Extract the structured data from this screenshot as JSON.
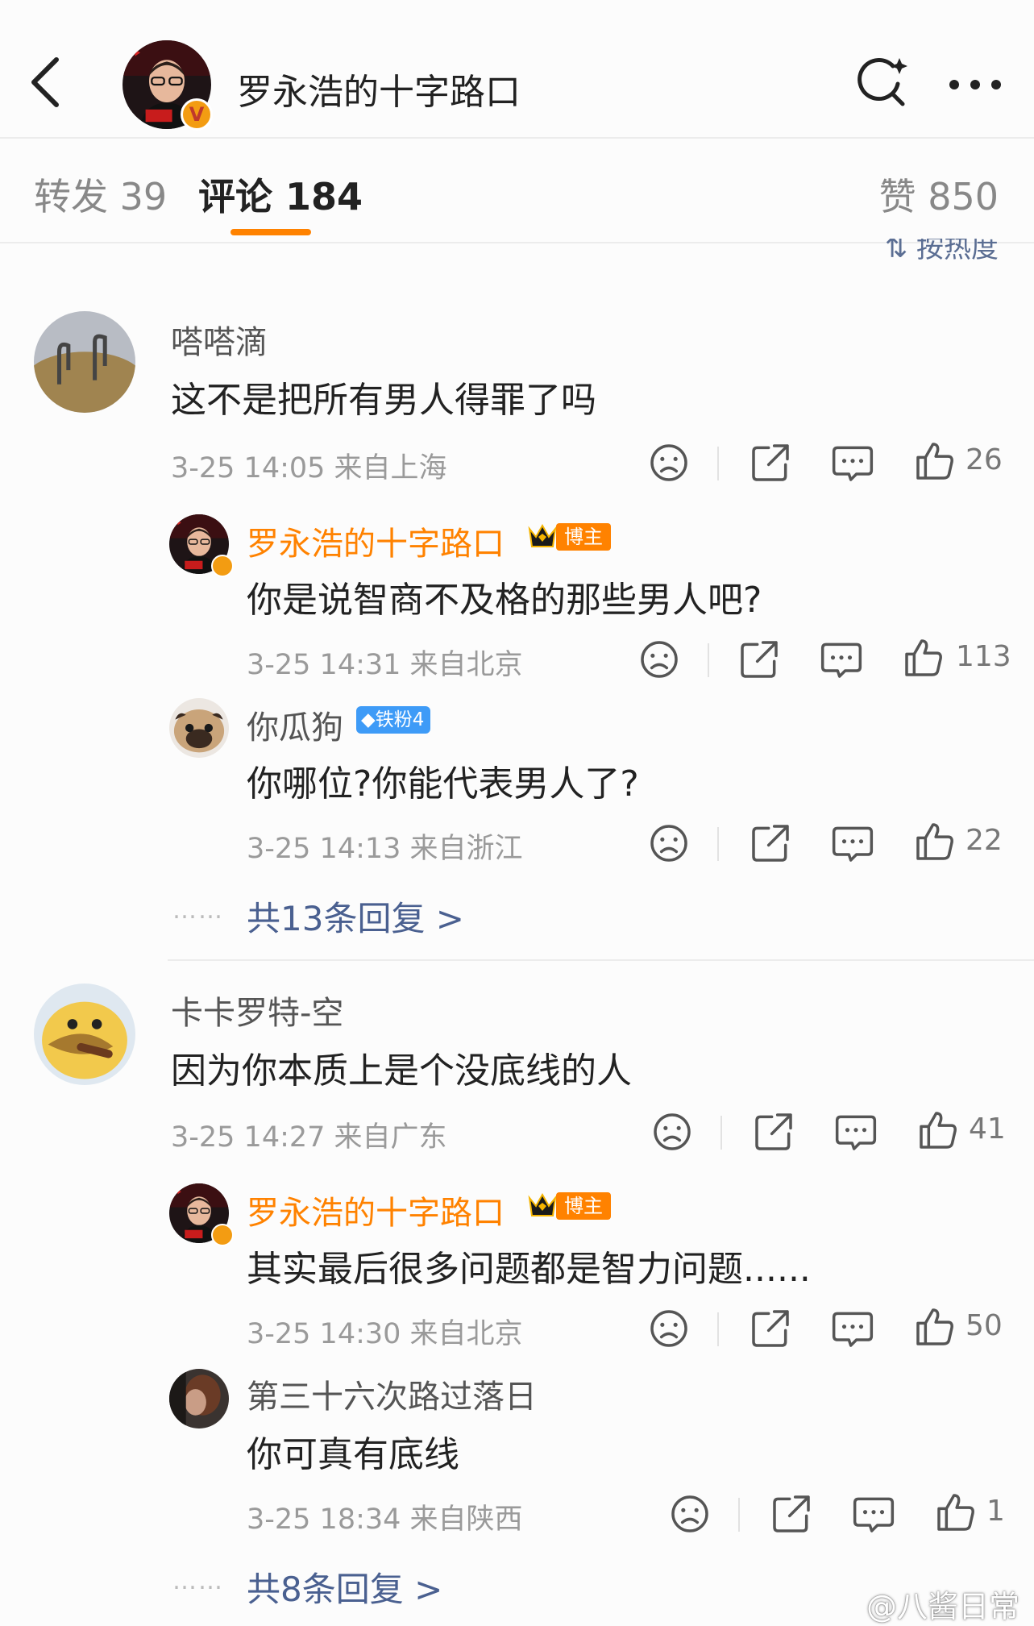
{
  "header": {
    "title": "罗永浩的十字路口",
    "icons": [
      "back-arrow-icon",
      "search-sparkle-icon",
      "more-dots-icon",
      "verified-v-badge-icon"
    ],
    "verified_badge": "V"
  },
  "tabs": {
    "repost": "转发 39",
    "comment": "评论 184",
    "like": "赞 850",
    "active": "comment",
    "accent_color": "#ff8200"
  },
  "sort": {
    "label": "按热度"
  },
  "comments": [
    {
      "user": "嗒嗒滴",
      "text": "这不是把所有男人得罪了吗",
      "meta": "3-25 14:05  来自上海",
      "likes": "26",
      "replies": [
        {
          "user": "罗永浩的十字路口",
          "badge": "博主",
          "text": "你是说智商不及格的那些男人吧?",
          "meta": "3-25 14:31  来自北京",
          "likes": "113"
        },
        {
          "user": "你瓜狗",
          "badge": "铁粉4",
          "text": "你哪位?你能代表男人了?",
          "meta": "3-25 14:13  来自浙江",
          "likes": "22"
        }
      ],
      "more_replies": "共13条回复 >"
    },
    {
      "user": "卡卡罗特-空",
      "text": "因为你本质上是个没底线的人",
      "meta": "3-25 14:27  来自广东",
      "likes": "41",
      "replies": [
        {
          "user": "罗永浩的十字路口",
          "badge": "博主",
          "text": "其实最后很多问题都是智力问题......",
          "meta": "3-25 14:30  来自北京",
          "likes": "50"
        },
        {
          "user": "第三十六次路过落日",
          "text": "你可真有底线",
          "meta": "3-25 18:34  来自陕西",
          "likes": "1"
        }
      ],
      "more_replies": "共8条回复 >"
    }
  ],
  "common": {
    "dots": "……",
    "action_icons": [
      "sad-face-icon",
      "share-icon",
      "comment-icon",
      "thumbs-up-icon"
    ]
  },
  "watermark": "@八酱日常",
  "colors": {
    "blogger_name": "#ff8200",
    "link": "#4a6090",
    "fan_badge": "#3e9bf7"
  }
}
